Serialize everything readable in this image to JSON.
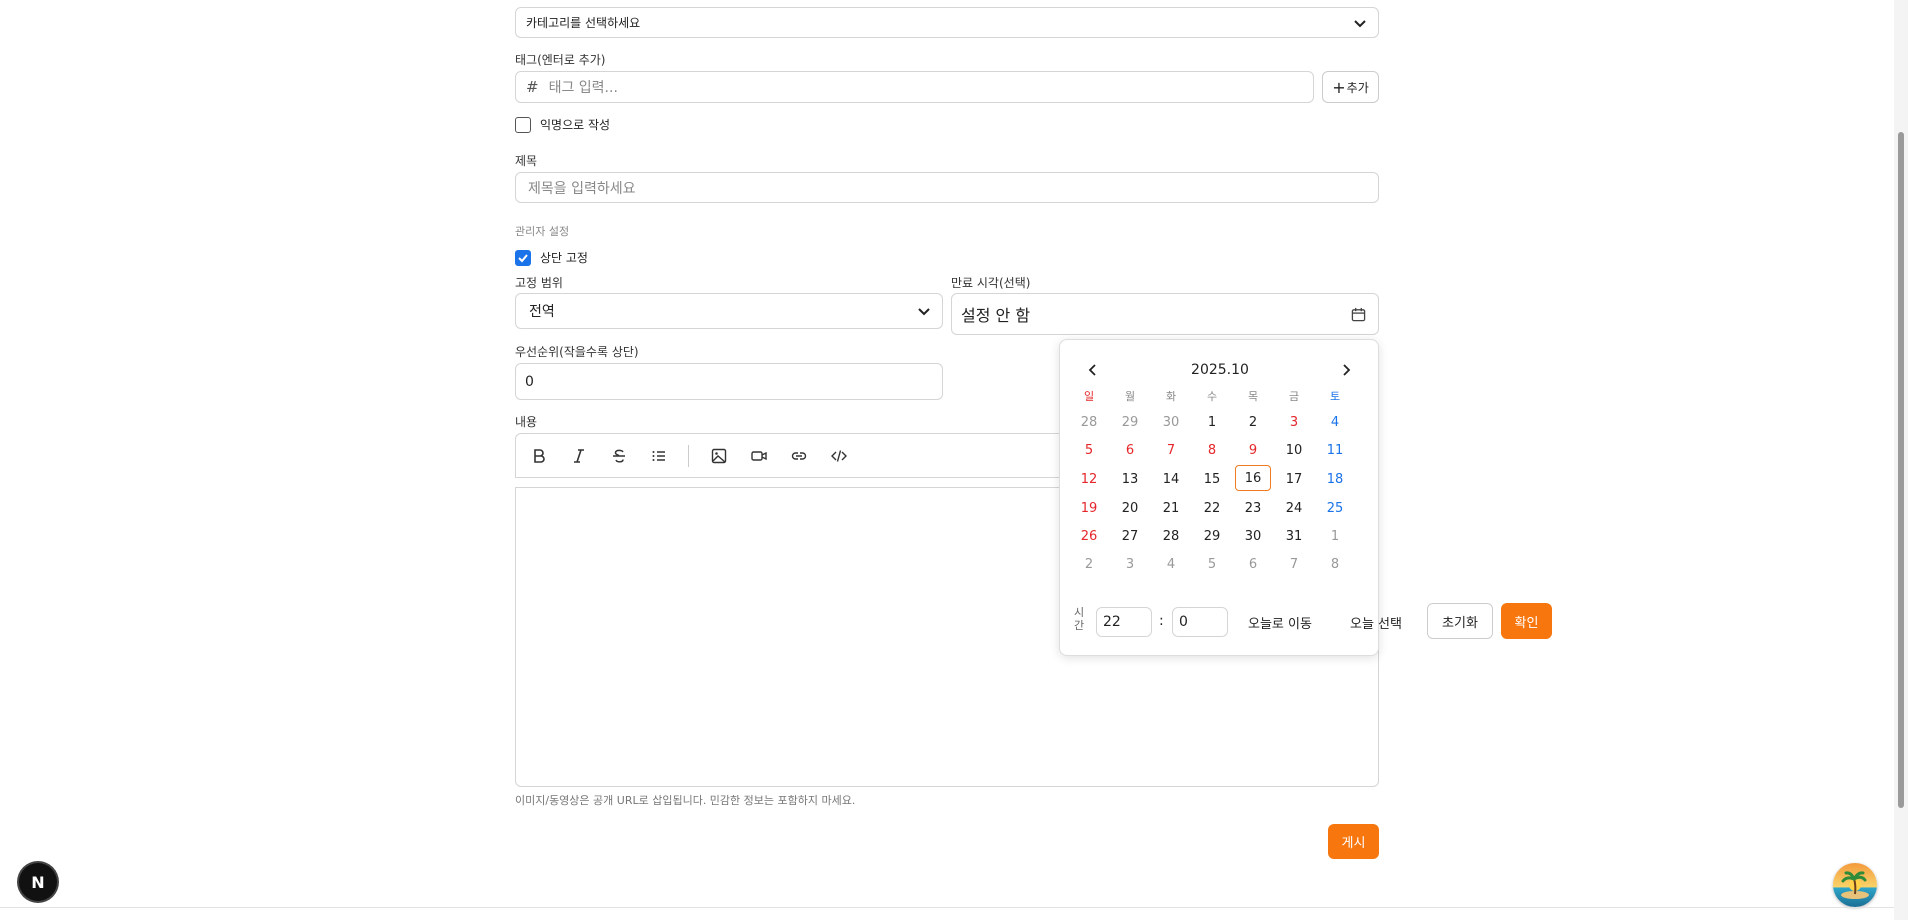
{
  "form": {
    "category_placeholder": "카테고리를 선택하세요",
    "tags_label": "태그(엔터로 추가)",
    "tag_input_placeholder": "태그 입력...",
    "tag_add_button": "추가",
    "anonymous_label": "익명으로 작성",
    "title_label": "제목",
    "title_placeholder": "제목을 입력하세요",
    "admin_section_label": "관리자 설정",
    "pin_top_label": "상단 고정",
    "pin_scope_label": "고정 범위",
    "pin_scope_value": "전역",
    "expiry_label": "만료 시각(선택)",
    "expiry_value": "설정 안 함",
    "priority_label": "우선순위(작을수록 상단)",
    "priority_value": "0",
    "content_label": "내용",
    "helper_text": "이미지/동영상은 공개 URL로 삽입됩니다. 민감한 정보는 포함하지 마세요.",
    "submit_button": "게시"
  },
  "calendar": {
    "month_title": "2025.10",
    "weekdays": [
      "일",
      "월",
      "화",
      "수",
      "목",
      "금",
      "토"
    ],
    "weeks": [
      [
        "28",
        "29",
        "30",
        "1",
        "2",
        "3",
        "4"
      ],
      [
        "5",
        "6",
        "7",
        "8",
        "9",
        "10",
        "11"
      ],
      [
        "12",
        "13",
        "14",
        "15",
        "16",
        "17",
        "18"
      ],
      [
        "19",
        "20",
        "21",
        "22",
        "23",
        "24",
        "25"
      ],
      [
        "26",
        "27",
        "28",
        "29",
        "30",
        "31",
        "1"
      ],
      [
        "2",
        "3",
        "4",
        "5",
        "6",
        "7",
        "8"
      ]
    ],
    "time_label": "시간",
    "hour_value": "22",
    "minute_value": "0",
    "time_separator": ":",
    "go_today": "오늘로 이동",
    "select_today": "오늘 선택",
    "reset": "초기화",
    "confirm": "확인"
  },
  "colors": {
    "accent": "#f7760e",
    "sunday": "#e5262b",
    "saturday": "#1a73e8",
    "checkbox": "#1a73e8"
  },
  "badge": {
    "letter": "N"
  }
}
